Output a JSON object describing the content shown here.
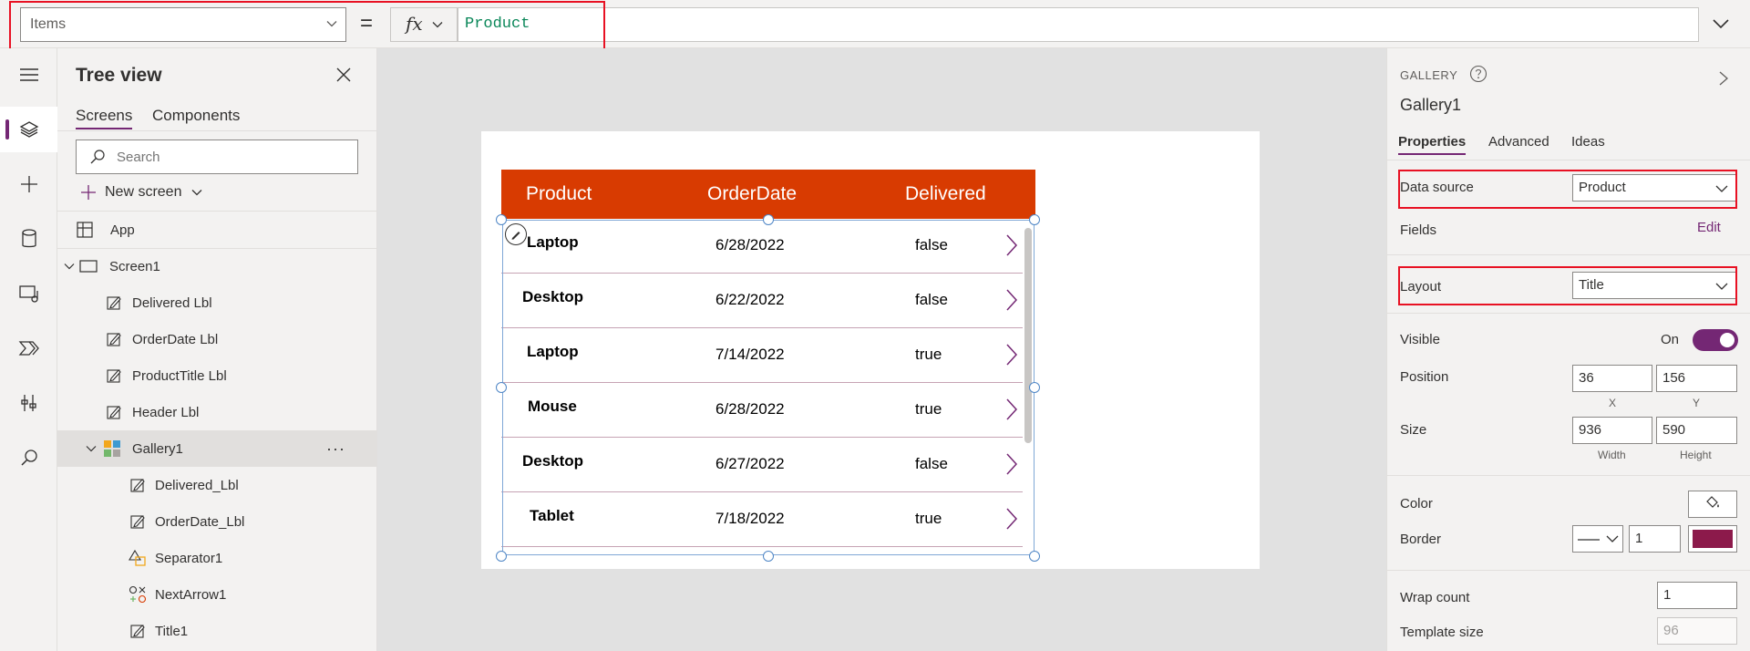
{
  "formula_bar": {
    "property": "Items",
    "equals": "=",
    "fx": "fx",
    "formula": "Product"
  },
  "tree_view": {
    "title": "Tree view",
    "tabs": [
      "Screens",
      "Components"
    ],
    "active_tab": "Screens",
    "search_placeholder": "Search",
    "new_screen": "New screen",
    "nodes": [
      {
        "label": "App",
        "icon": "app-icon"
      },
      {
        "label": "Screen1",
        "icon": "screen-icon"
      },
      {
        "label": "Delivered Lbl",
        "icon": "label-icon"
      },
      {
        "label": "OrderDate Lbl",
        "icon": "label-icon"
      },
      {
        "label": "ProductTitle Lbl",
        "icon": "label-icon"
      },
      {
        "label": "Header Lbl",
        "icon": "label-icon"
      },
      {
        "label": "Gallery1",
        "icon": "gallery-icon",
        "selected": true
      },
      {
        "label": "Delivered_Lbl",
        "icon": "label-icon"
      },
      {
        "label": "OrderDate_Lbl",
        "icon": "label-icon"
      },
      {
        "label": "Separator1",
        "icon": "shapes-icon"
      },
      {
        "label": "NextArrow1",
        "icon": "icons-icon"
      },
      {
        "label": "Title1",
        "icon": "label-icon"
      }
    ],
    "more": "···"
  },
  "gallery": {
    "header": [
      "Product",
      "OrderDate",
      "Delivered"
    ],
    "header_color": "#d83b01",
    "rows": [
      {
        "title": "Laptop",
        "date": "6/28/2022",
        "delivered": "false"
      },
      {
        "title": "Desktop",
        "date": "6/22/2022",
        "delivered": "false"
      },
      {
        "title": "Laptop",
        "date": "7/14/2022",
        "delivered": "true"
      },
      {
        "title": "Mouse",
        "date": "6/28/2022",
        "delivered": "true"
      },
      {
        "title": "Desktop",
        "date": "6/27/2022",
        "delivered": "false"
      },
      {
        "title": "Tablet",
        "date": "7/18/2022",
        "delivered": "true"
      }
    ]
  },
  "properties_panel": {
    "type": "GALLERY",
    "name": "Gallery1",
    "tabs": [
      "Properties",
      "Advanced",
      "Ideas"
    ],
    "active_tab": "Properties",
    "data_source_label": "Data source",
    "data_source_value": "Product",
    "fields_label": "Fields",
    "fields_edit": "Edit",
    "layout_label": "Layout",
    "layout_value": "Title",
    "visible_label": "Visible",
    "visible_state": "On",
    "position_label": "Position",
    "position_x": "36",
    "position_y": "156",
    "x_label": "X",
    "y_label": "Y",
    "size_label": "Size",
    "width": "936",
    "height": "590",
    "width_label": "Width",
    "height_label": "Height",
    "color_label": "Color",
    "border_label": "Border",
    "border_width": "1",
    "border_color": "#8c1a4b",
    "wrap_count_label": "Wrap count",
    "wrap_count": "1",
    "template_size_label": "Template size",
    "template_size": "96"
  },
  "accent_color": "#742774"
}
